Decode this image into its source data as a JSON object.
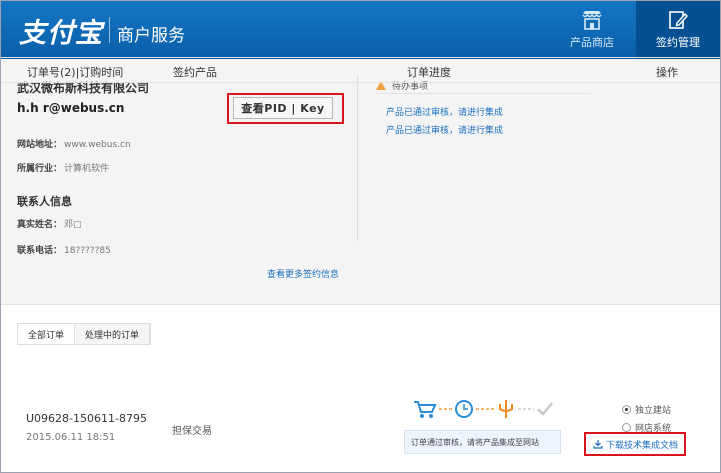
{
  "header": {
    "logo": "支付宝",
    "subtitle": "商户服务",
    "nav": [
      {
        "label": "产品商店",
        "icon": "shop-icon"
      },
      {
        "label": "签约管理",
        "icon": "edit-icon"
      }
    ]
  },
  "account": {
    "company": "武汉微布斯科技有限公司",
    "email": "h.h r@webus.cn",
    "pid_button": "查看PID | Key",
    "website_label": "网站地址：",
    "website_value": "www.webus.cn",
    "industry_label": "所属行业：",
    "industry_value": "计算机软件",
    "contact_title": "联系人信息",
    "name_label": "真实姓名：",
    "name_value": "邓□",
    "phone_label": "联系电话：",
    "phone_value": "18?????85",
    "more_link": "查看更多签约信息"
  },
  "todo": {
    "title": "待办事项",
    "items": [
      "产品已通过审核，请进行集成",
      "产品已通过审核，请进行集成"
    ]
  },
  "orders": {
    "tabs": [
      "全部订单",
      "处理中的订单"
    ],
    "headers": {
      "order": "订单号(2)|订购时间",
      "product": "签约产品",
      "progress": "订单进度",
      "action": "操作"
    },
    "rows": [
      {
        "order_no": "U09628-150611-8795",
        "time": "2015.06.11 18:51",
        "product": "担保交易",
        "tip": "订单通过审核，请将产品集成至网站",
        "options": [
          "独立建站",
          "网店系统"
        ],
        "selected": "独立建站",
        "download": "下载技术集成文档"
      }
    ]
  },
  "colors": {
    "brand_blue": "#0a5ea8",
    "highlight_red": "#d8151e",
    "link_blue": "#1a6fc0"
  }
}
